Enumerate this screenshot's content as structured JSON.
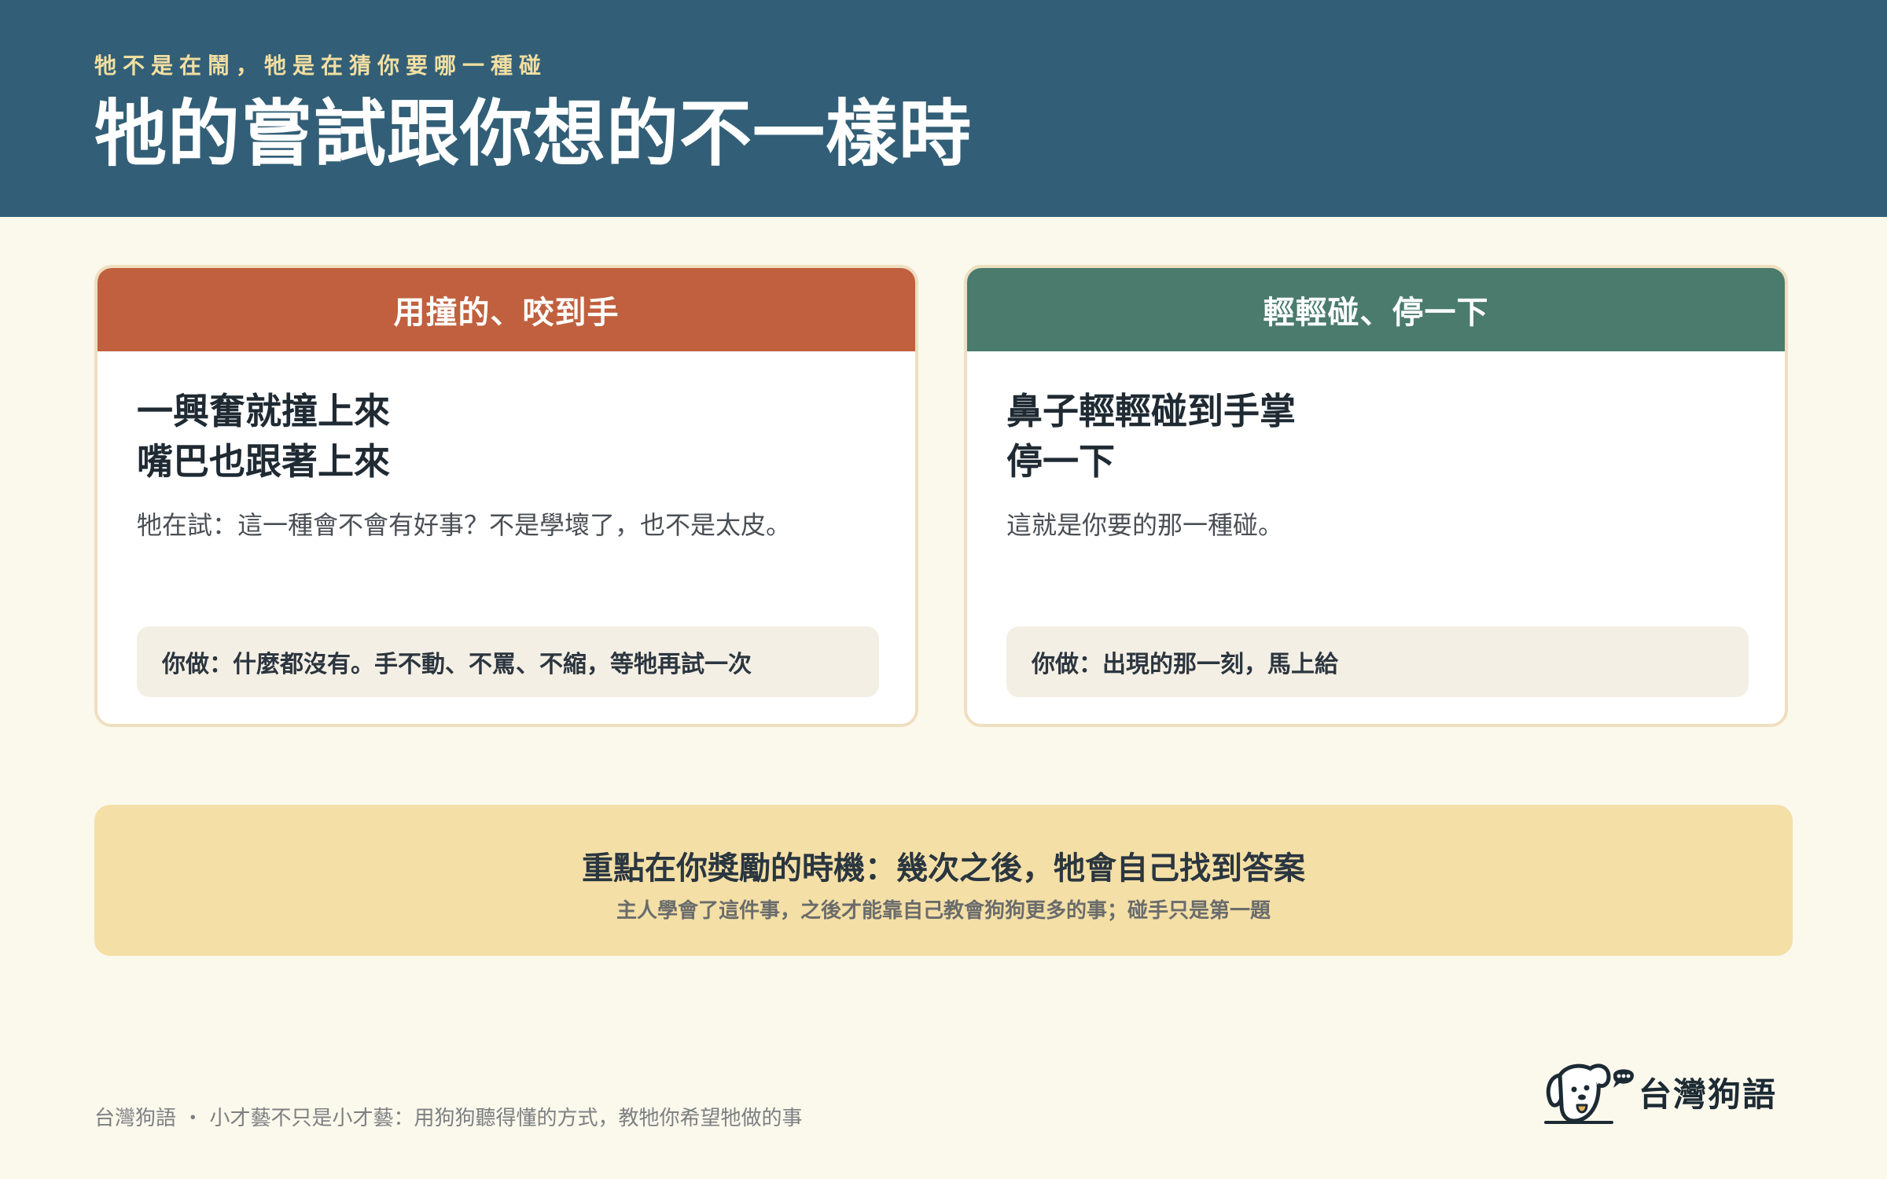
{
  "header": {
    "kicker": "牠不是在鬧，牠是在猜你要哪一種碰",
    "title": "牠的嘗試跟你想的不一樣時"
  },
  "cards": [
    {
      "heading": "用撞的、咬到手",
      "title_lines": [
        "一興奮就撞上來",
        "嘴巴也跟著上來"
      ],
      "description": "牠在試：這一種會不會有好事？不是學壞了，也不是太皮。",
      "action": "你做：什麼都沒有。手不動、不罵、不縮，等牠再試一次"
    },
    {
      "heading": "輕輕碰、停一下",
      "title_lines": [
        "鼻子輕輕碰到手掌",
        "停一下"
      ],
      "description": "這就是你要的那一種碰。",
      "action": "你做：出現的那一刻，馬上給"
    }
  ],
  "highlight": {
    "main": "重點在你獎勵的時機：幾次之後，牠會自己找到答案",
    "sub": "主人學會了這件事，之後才能靠自己教會狗狗更多的事；碰手只是第一題"
  },
  "footer": {
    "note": "台灣狗語 ・ 小才藝不只是小才藝：用狗狗聽得懂的方式，教牠你希望牠做的事",
    "brand_name": "台灣狗語",
    "logo_icon": "dog-speech-logo-icon"
  },
  "colors": {
    "header_bg": "#325F77",
    "kicker": "#F3DFA2",
    "card_left_head": "#C0603E",
    "card_right_head": "#4A7B6D",
    "highlight_bg": "#F4DFA6",
    "page_bg": "#FBF8EC"
  }
}
